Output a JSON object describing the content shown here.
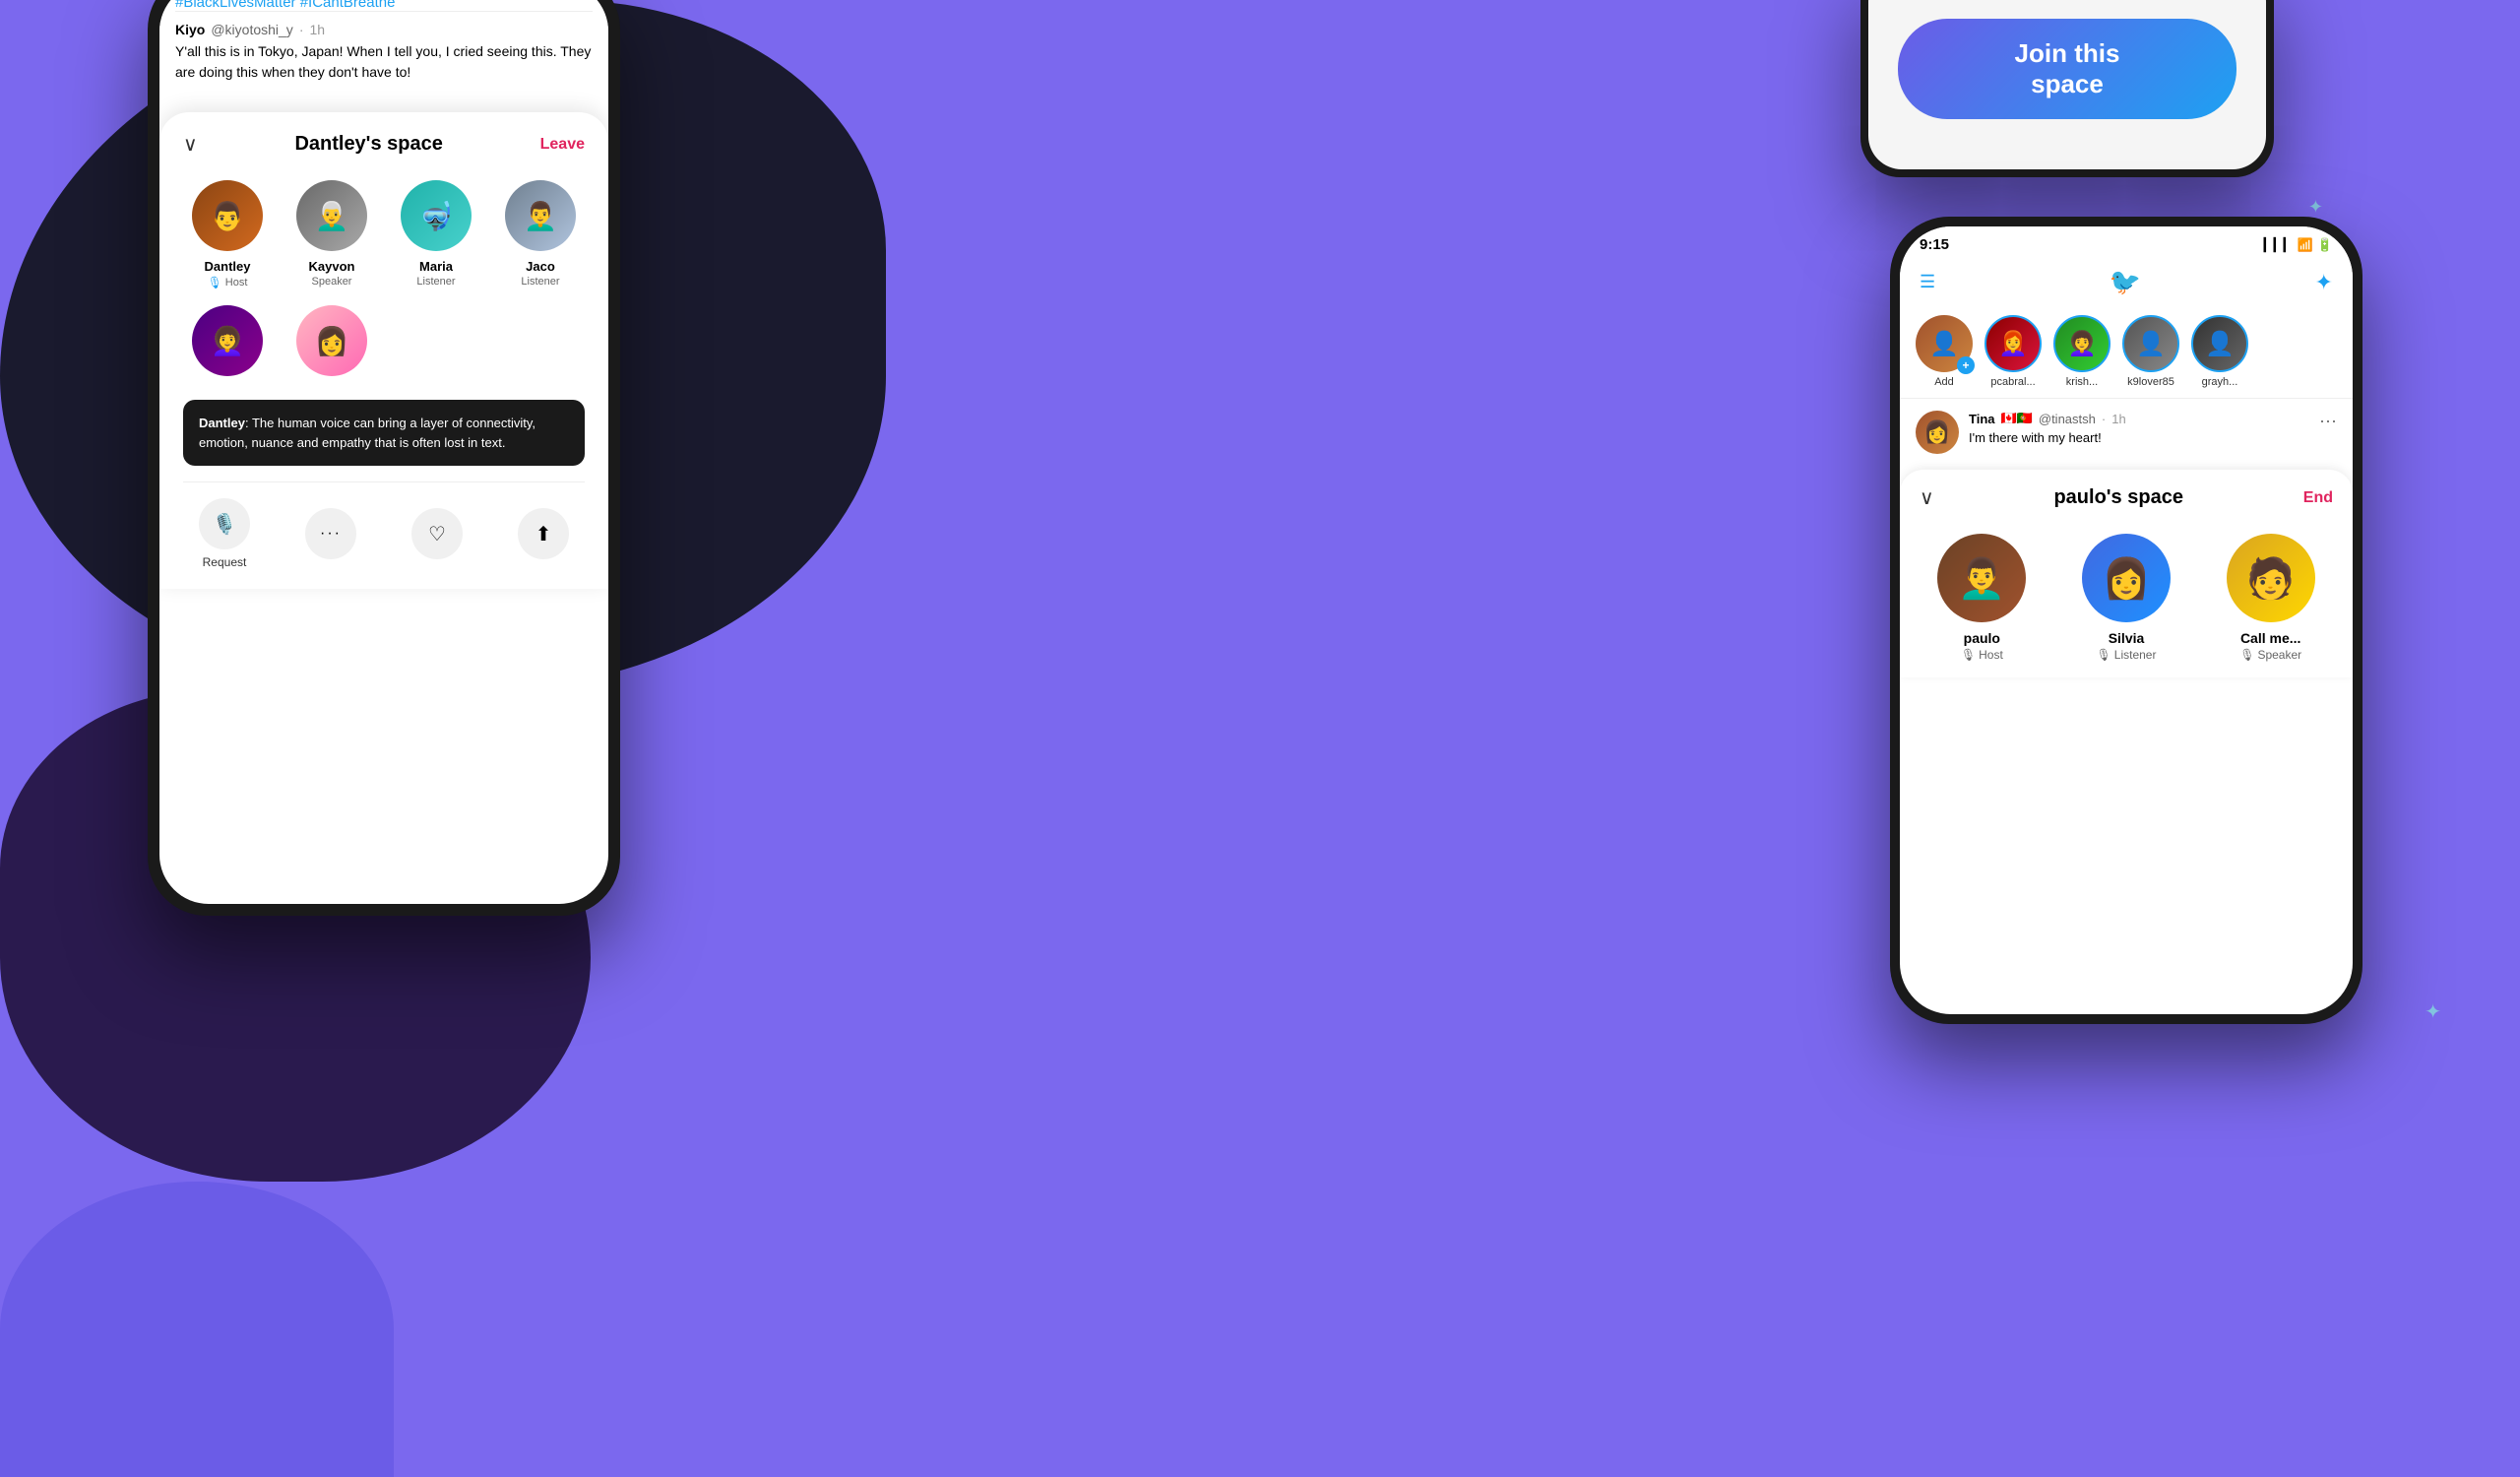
{
  "background": {
    "color": "#7B68EE"
  },
  "phone_left": {
    "tweet_feed": {
      "hashtags": "#BlackLivesMatter #ICantBreathe",
      "tweet": {
        "author": "Kiyo",
        "handle": "@kiyotoshi_y",
        "time": "1h",
        "text": "Y'all this is in Tokyo, Japan! When I tell you, I cried seeing this. They are doing this when they don't have to!"
      }
    },
    "space": {
      "title": "Dantley's space",
      "leave_label": "Leave",
      "speakers": [
        {
          "name": "Dantley",
          "role": "Host",
          "is_host": true,
          "avatar_class": "av-dantley"
        },
        {
          "name": "Kayvon",
          "role": "Speaker",
          "is_host": false,
          "avatar_class": "av-kayvon"
        },
        {
          "name": "Maria",
          "role": "Listener",
          "is_host": false,
          "avatar_class": "av-maria"
        },
        {
          "name": "Jaco",
          "role": "Listener",
          "is_host": false,
          "avatar_class": "av-jaco"
        }
      ],
      "extra_speakers": [
        {
          "avatar_class": "av-woman"
        },
        {
          "avatar_class": "av-pink"
        }
      ],
      "speech_bubble": {
        "author": "Dantley",
        "text": "The human voice can bring a layer of connectivity, emotion, nuance and empathy that is often lost in text."
      },
      "controls": {
        "request_label": "Request",
        "mic_icon": "🎙️",
        "more_icon": "···",
        "heart_icon": "♡",
        "share_icon": "⬆"
      }
    }
  },
  "phone_top_right": {
    "join_button_label": "Join this space"
  },
  "phone_right": {
    "status_bar": {
      "time": "9:15",
      "signal": "▎▎▎",
      "wifi": "WiFi",
      "battery": "Battery"
    },
    "stories": [
      {
        "label": "Add",
        "avatar_class": "av-tina",
        "has_add": true
      },
      {
        "label": "pcabral...",
        "avatar_class": "av-pcabral",
        "has_add": false
      },
      {
        "label": "krish...",
        "avatar_class": "av-krish",
        "has_add": false
      },
      {
        "label": "k9lover85",
        "avatar_class": "av-k9lover",
        "has_add": false
      },
      {
        "label": "grayh...",
        "avatar_class": "av-grayh",
        "has_add": false
      }
    ],
    "tweet": {
      "author": "Tina",
      "flags": "🇨🇦🇵🇹",
      "handle": "@tinastsh",
      "time": "1h",
      "text": "I'm there with my heart!"
    },
    "space": {
      "title": "paulo's space",
      "end_label": "End",
      "speakers": [
        {
          "name": "paulo",
          "role": "Host",
          "is_host": true,
          "avatar_class": "av-paulo"
        },
        {
          "name": "Silvia",
          "role": "Listener",
          "is_host": false,
          "avatar_class": "av-silvia"
        },
        {
          "name": "Call me...",
          "role": "Speaker",
          "is_host": false,
          "avatar_class": "av-callme"
        }
      ]
    }
  }
}
